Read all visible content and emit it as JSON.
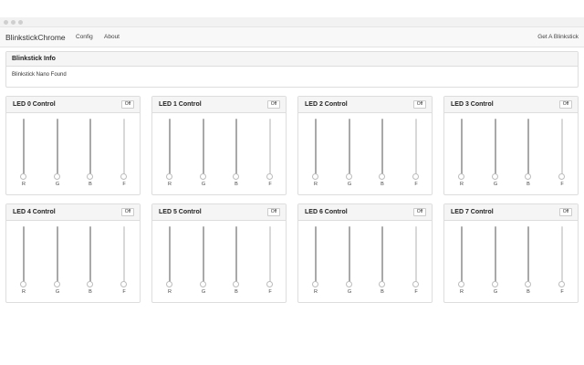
{
  "app": {
    "title": "BlinkstickChrome"
  },
  "nav": {
    "config": "Config",
    "about": "About",
    "get": "Get A Blinkstick"
  },
  "info": {
    "title": "Blinkstick Info",
    "status": "Blinkstick Nano Found"
  },
  "leds": [
    {
      "title": "LED 0 Control",
      "button": "Off",
      "sliders": [
        {
          "label": "R",
          "value": 0
        },
        {
          "label": "G",
          "value": 0
        },
        {
          "label": "B",
          "value": 0
        },
        {
          "label": "F",
          "value": 0
        }
      ]
    },
    {
      "title": "LED 1 Control",
      "button": "Off",
      "sliders": [
        {
          "label": "R",
          "value": 0
        },
        {
          "label": "G",
          "value": 0
        },
        {
          "label": "B",
          "value": 0
        },
        {
          "label": "F",
          "value": 0
        }
      ]
    },
    {
      "title": "LED 2 Control",
      "button": "Off",
      "sliders": [
        {
          "label": "R",
          "value": 0
        },
        {
          "label": "G",
          "value": 0
        },
        {
          "label": "B",
          "value": 0
        },
        {
          "label": "F",
          "value": 0
        }
      ]
    },
    {
      "title": "LED 3 Control",
      "button": "Off",
      "sliders": [
        {
          "label": "R",
          "value": 0
        },
        {
          "label": "G",
          "value": 0
        },
        {
          "label": "B",
          "value": 0
        },
        {
          "label": "F",
          "value": 0
        }
      ]
    },
    {
      "title": "LED 4 Control",
      "button": "Off",
      "sliders": [
        {
          "label": "R",
          "value": 0
        },
        {
          "label": "G",
          "value": 0
        },
        {
          "label": "B",
          "value": 0
        },
        {
          "label": "F",
          "value": 0
        }
      ]
    },
    {
      "title": "LED 5 Control",
      "button": "Off",
      "sliders": [
        {
          "label": "R",
          "value": 0
        },
        {
          "label": "G",
          "value": 0
        },
        {
          "label": "B",
          "value": 0
        },
        {
          "label": "F",
          "value": 0
        }
      ]
    },
    {
      "title": "LED 6 Control",
      "button": "Off",
      "sliders": [
        {
          "label": "R",
          "value": 0
        },
        {
          "label": "G",
          "value": 0
        },
        {
          "label": "B",
          "value": 0
        },
        {
          "label": "F",
          "value": 0
        }
      ]
    },
    {
      "title": "LED 7 Control",
      "button": "Off",
      "sliders": [
        {
          "label": "R",
          "value": 0
        },
        {
          "label": "G",
          "value": 0
        },
        {
          "label": "B",
          "value": 0
        },
        {
          "label": "F",
          "value": 0
        }
      ]
    }
  ]
}
